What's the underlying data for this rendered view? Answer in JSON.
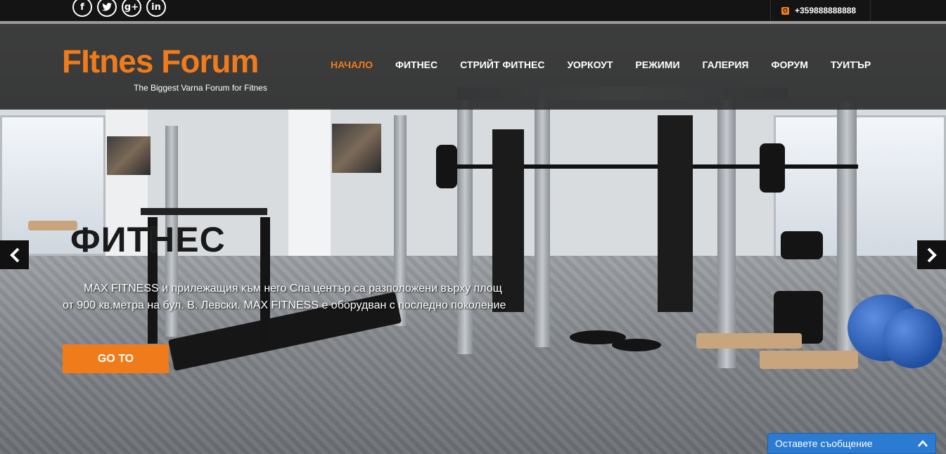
{
  "social": {
    "facebook": "f",
    "twitter": "t",
    "googleplus": "g+",
    "linkedin": "in"
  },
  "contact": {
    "phone": "+359888888888",
    "icon": "phone-icon"
  },
  "brand": {
    "logo": "FItnes Forum",
    "tagline": "The Biggest Varna Forum for Fitnes",
    "accent": "#f07b1a"
  },
  "nav": {
    "items": [
      {
        "label": "НАЧАЛО"
      },
      {
        "label": "ФИТНЕС"
      },
      {
        "label": "СТРИЙТ ФИТНЕС"
      },
      {
        "label": "УОРКОУТ"
      },
      {
        "label": "РЕЖИМИ"
      },
      {
        "label": "ГАЛЕРИЯ"
      },
      {
        "label": "ФОРУМ"
      },
      {
        "label": "ТУИТЪР"
      }
    ],
    "active_index": 0
  },
  "slide": {
    "title": "ФИТНЕС",
    "text": "MAX FITNESS и прилежащия към него Спа център са разположени върху площ от 900 кв.метра на бул. В. Левски. MAX FITNESS е оборудван с последно поколение",
    "button": "GO TO",
    "prev_icon": "chevron-left-icon",
    "next_icon": "chevron-right-icon"
  },
  "chat": {
    "label": "Оставете съобщение",
    "icon": "chevron-up-icon",
    "color": "#2a7bd1"
  }
}
